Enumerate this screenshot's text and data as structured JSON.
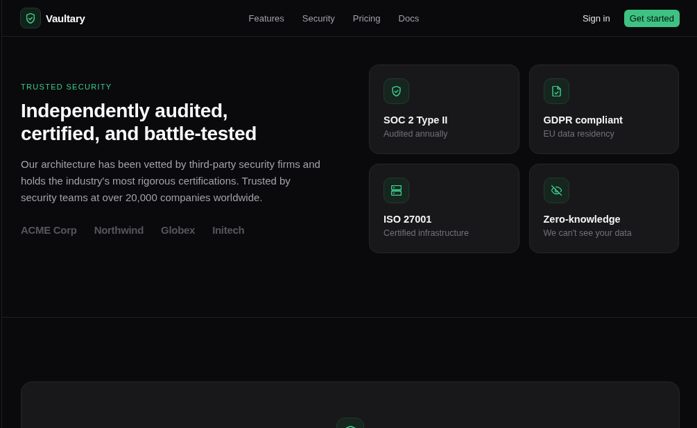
{
  "header": {
    "brand": "Vaultary",
    "nav": [
      {
        "label": "Features"
      },
      {
        "label": "Security"
      },
      {
        "label": "Pricing"
      },
      {
        "label": "Docs"
      }
    ],
    "sign_in": "Sign in",
    "cta": "Get started"
  },
  "hero": {
    "eyebrow": "TRUSTED SECURITY",
    "heading": "Independently audited, certified, and battle-tested",
    "body": "Our architecture has been vetted by third-party security firms and holds the industry's most rigorous certifications. Trusted by security teams at over 20,000 companies worldwide.",
    "logos": [
      "ACME Corp",
      "Northwind",
      "Globex",
      "Initech"
    ]
  },
  "certifications": [
    {
      "kind": "shield",
      "title": "SOC 2 Type II",
      "subtitle": "Audited annually"
    },
    {
      "kind": "document",
      "title": "GDPR compliant",
      "subtitle": "EU data residency"
    },
    {
      "kind": "server",
      "title": "ISO 27001",
      "subtitle": "Certified infrastructure"
    },
    {
      "kind": "eye-off",
      "title": "Zero-knowledge",
      "subtitle": "We can't see your data"
    }
  ],
  "next_section": {
    "kind": "shield"
  }
}
